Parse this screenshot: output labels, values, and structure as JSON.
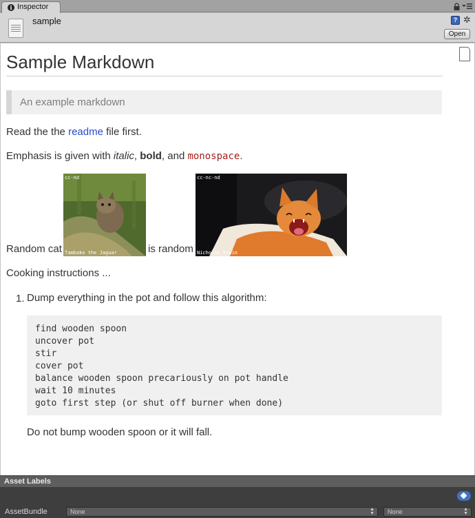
{
  "tab": {
    "label": "Inspector"
  },
  "header": {
    "asset_name": "sample",
    "open_label": "Open"
  },
  "markdown": {
    "title": "Sample Markdown",
    "blockquote": "An example markdown",
    "readme": {
      "before": "Read the the ",
      "link": "readme",
      "after": " file first."
    },
    "emphasis": {
      "before": "Emphasis is given with ",
      "italic": "italic",
      "sep1": ", ",
      "bold": "bold",
      "sep2": ", and ",
      "mono": "monospace",
      "end": "."
    },
    "cat_line": {
      "before": "Random cat",
      "between": "is random"
    },
    "images": [
      {
        "license": "cc-nd",
        "credit": "Tambako the Jaguar"
      },
      {
        "license": "cc-nc-nd",
        "credit": "Nicholas Erwin"
      }
    ],
    "cooking": "Cooking instructions ...",
    "list_item": {
      "number": "1.",
      "text": "Dump everything in the pot and follow this algorithm:"
    },
    "code": [
      "find wooden spoon",
      "uncover pot",
      "stir",
      "cover pot",
      "balance wooden spoon precariously on pot handle",
      "wait 10 minutes",
      "goto first step (or shut off burner when done)"
    ],
    "footer": "Do not bump wooden spoon or it will fall."
  },
  "asset_labels": {
    "header": "Asset Labels"
  },
  "asset_bundle": {
    "label": "AssetBundle",
    "bundle_value": "None",
    "variant_value": "None"
  },
  "colors": {
    "link": "#2b4bc8",
    "mono": "#a51d1d",
    "label_tag": "#3f72c6"
  }
}
